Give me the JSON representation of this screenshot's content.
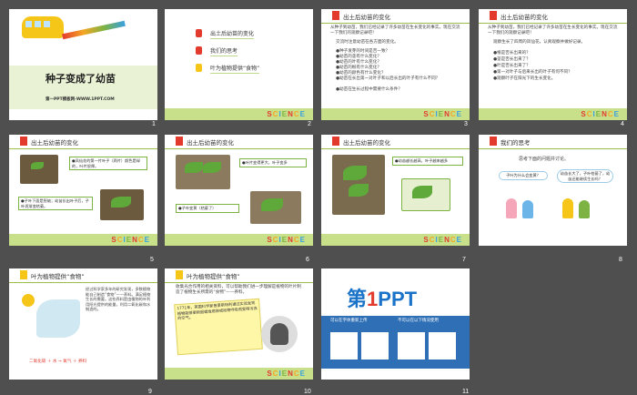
{
  "slides": [
    {
      "num": "1",
      "title": "种子变成了幼苗",
      "subtitle": "第一PPT模板网-WWW.1PPT.COM"
    },
    {
      "num": "2",
      "menu": [
        "出土后幼苗的变化",
        "我们的思考",
        "叶为植物提供“食物”"
      ]
    },
    {
      "num": "3",
      "header": "出土后幼苗的变化",
      "p1": "从种子到幼苗，我们已经记录了许多幼苗在生长变化的事实。现在交流一下我们的观察记录吧！",
      "p2": "交流时注意幼苗在各方面的变化。",
      "bullets": [
        "●种子发芽的时间是否一致？",
        "●幼苗的茎有什么变化？",
        "●幼苗的叶有什么变化？",
        "●幼苗的根有什么变化？",
        "●幼苗的颜色有什么变化？",
        "●幼苗在长出第一对叶子和以后长出的叶子有什么不同？",
        "●幼苗在生长过程中需要什么条件？"
      ]
    },
    {
      "num": "4",
      "header": "出土后幼苗的变化",
      "p1": "从种子到幼苗，我们已经记录了许多幼苗在生长变化的事实。现在交流一下我们的观察记录吧！",
      "p2": "观察生长了四周的凤仙花，认真观察并做好记录。",
      "bullets": [
        "●根是否长出来的？",
        "●茎是否长出来了？",
        "●叶是否长出来了？",
        "●第一对叶子与后来长出的叶子有何不同？",
        "●观察叶子在阳光下的生长变化。"
      ]
    },
    {
      "num": "5",
      "header": "出土后幼苗的变化",
      "b1": "●凤仙花的第一片叶子（两片）颜色是绿的，叶片很厚。",
      "b2": "●子叶下面是胚轴；幼苗长出叶子后，子叶逐渐变枯萎。"
    },
    {
      "num": "6",
      "header": "出土后幼苗的变化",
      "b1": "●叶片变得更大，叶子变多",
      "b2": "●子叶变黄（枯萎了）"
    },
    {
      "num": "7",
      "header": "出土后幼苗的变化",
      "b1": "●幼苗越长越高，叶子越来越多"
    },
    {
      "num": "8",
      "header": "我们的思考",
      "q": "思考下面的问题并讨论。",
      "c1": "子叶为什么会变黄？",
      "c2": "幼苗长大了，子叶枯萎了，幼苗还能继续生长吗？"
    },
    {
      "num": "9",
      "header": "叶为植物提供“食物”",
      "p": "经过科学家多年的研究发现，多数植物能自己制造“食物”——养料。满足植物生长的需要。这些养料是由植物的叶利用阳光提供的能量，利用二氧化碳和水制造的。",
      "eq": "二氧化碳 ＋ 水 → 氧气 ＋ 养料"
    },
    {
      "num": "10",
      "header": "叶为植物提供“食物”",
      "p": "收集光合作用的相关资料，可以帮助我们进一步理解是植物的叶片制造了植物生长所需的“食物”——养料。",
      "note": "1771年，英国科学家普里斯特利通过实验发现植物能够更新因蜡烛燃烧或动物呼吸而变得污浊的空气。"
    },
    {
      "num": "11",
      "logo_a": "第",
      "logo_b": "1",
      "logo_c": "PPT",
      "c1": "可以在字体重新上传",
      "c2": "不可以在以下情况使用"
    }
  ]
}
